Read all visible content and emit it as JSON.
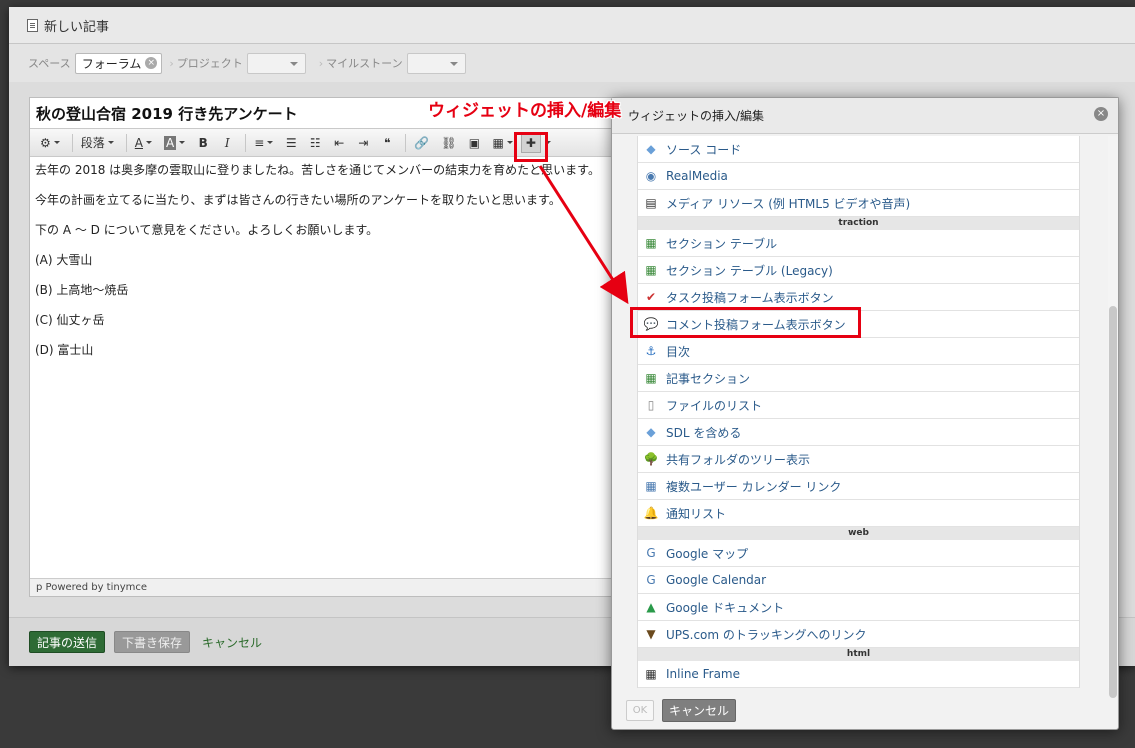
{
  "window": {
    "title": "新しい記事"
  },
  "fields": {
    "space_label": "スペース",
    "space_value": "フォーラム",
    "project_label": "プロジェクト",
    "milestone_label": "マイルストーン"
  },
  "editor": {
    "title": "秋の登山合宿 2019 行き先アンケート",
    "toolbar": {
      "paragraph_label": "段落"
    },
    "paragraphs": [
      "去年の 2018 は奥多摩の雲取山に登りましたね。苦しさを通じてメンバーの結束力を育めたと思います。",
      "今年の計画を立てるに当たり、まずは皆さんの行きたい場所のアンケートを取りたいと思います。",
      "下の A 〜 D について意見をください。よろしくお願いします。",
      "(A) 大雪山",
      "(B) 上高地〜焼岳",
      "(C) 仙丈ヶ岳",
      "(D) 富士山"
    ],
    "status": "p   Powered by tinymce"
  },
  "footer": {
    "submit": "記事の送信",
    "draft": "下書き保存",
    "cancel": "キャンセル"
  },
  "annotation": "ウィジェットの挿入/編集",
  "dialog": {
    "title": "ウィジェットの挿入/編集",
    "items": [
      {
        "type": "item",
        "label": "ソース コード",
        "icon": "code-icon"
      },
      {
        "type": "item",
        "label": "RealMedia",
        "icon": "realmedia-icon"
      },
      {
        "type": "item",
        "label": "メディア リソース (例 HTML5 ビデオや音声)",
        "icon": "film-icon"
      },
      {
        "type": "group",
        "label": "traction"
      },
      {
        "type": "item",
        "label": "セクション テーブル",
        "icon": "section-table-icon"
      },
      {
        "type": "item",
        "label": "セクション テーブル (Legacy)",
        "icon": "section-table-legacy-icon"
      },
      {
        "type": "item",
        "label": "タスク投稿フォーム表示ボタン",
        "icon": "task-form-icon"
      },
      {
        "type": "item",
        "label": "コメント投稿フォーム表示ボタン",
        "icon": "comment-form-icon"
      },
      {
        "type": "item",
        "label": "目次",
        "icon": "toc-icon"
      },
      {
        "type": "item",
        "label": "記事セクション",
        "icon": "article-section-icon"
      },
      {
        "type": "item",
        "label": "ファイルのリスト",
        "icon": "file-list-icon"
      },
      {
        "type": "item",
        "label": "SDL を含める",
        "icon": "sdl-icon"
      },
      {
        "type": "item",
        "label": "共有フォルダのツリー表示",
        "icon": "tree-icon"
      },
      {
        "type": "item",
        "label": "複数ユーザー カレンダー リンク",
        "icon": "calendar-users-icon"
      },
      {
        "type": "item",
        "label": "通知リスト",
        "icon": "bell-icon"
      },
      {
        "type": "group",
        "label": "web"
      },
      {
        "type": "item",
        "label": "Google マップ",
        "icon": "google-maps-icon"
      },
      {
        "type": "item",
        "label": "Google Calendar",
        "icon": "google-calendar-icon"
      },
      {
        "type": "item",
        "label": "Google ドキュメント",
        "icon": "google-drive-icon"
      },
      {
        "type": "item",
        "label": "UPS.com のトラッキングへのリンク",
        "icon": "ups-icon"
      },
      {
        "type": "group",
        "label": "html"
      },
      {
        "type": "item",
        "label": "Inline Frame",
        "icon": "iframe-icon"
      }
    ],
    "ok": "OK",
    "cancel": "キャンセル"
  },
  "colors": {
    "accent_red": "#e60012",
    "primary_green": "#2e6b35",
    "link_blue": "#2a5a8a"
  }
}
